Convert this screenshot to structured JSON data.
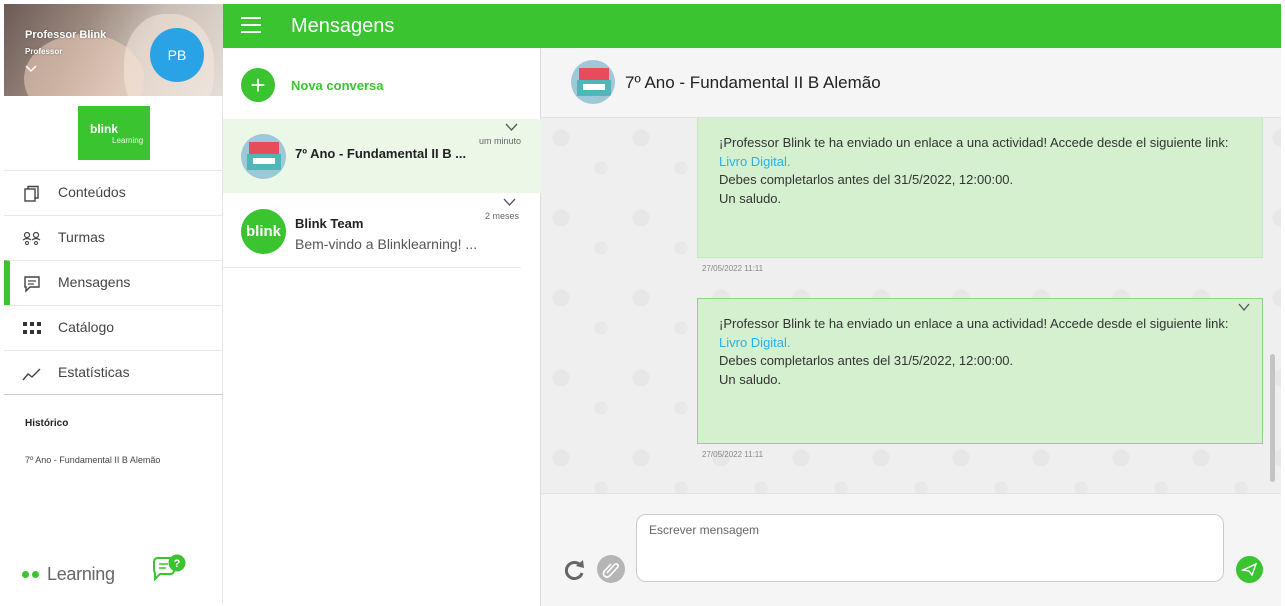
{
  "sidebar": {
    "profile": {
      "name": "Professor Blink",
      "role": "Professor",
      "initials": "PB"
    },
    "logo": {
      "line1": "blink",
      "line2": "Learning"
    },
    "items": [
      {
        "label": "Conteúdos",
        "icon": "document-icon"
      },
      {
        "label": "Turmas",
        "icon": "people-icon"
      },
      {
        "label": "Mensagens",
        "icon": "message-icon",
        "active": true
      },
      {
        "label": "Catálogo",
        "icon": "grid-icon"
      },
      {
        "label": "Estatísticas",
        "icon": "chart-icon"
      }
    ],
    "history": {
      "title": "Histórico",
      "items": [
        "7º Ano - Fundamental II B  Alemão"
      ]
    },
    "footer": {
      "logo_text": "Learning",
      "help_icon": "help-chat-icon"
    }
  },
  "topbar": {
    "title": "Mensagens",
    "menu_icon": "hamburger-icon"
  },
  "conversations": {
    "new_label": "Nova conversa",
    "items": [
      {
        "name": "7º Ano - Fundamental II B ...",
        "time": "um minuto",
        "selected": true
      },
      {
        "name": "Blink Team",
        "preview": "Bem-vindo a Blinklearning! ...",
        "time": "2 meses",
        "avatar_text": "blink"
      }
    ]
  },
  "chat": {
    "title": "7º Ano - Fundamental II B  Alemão",
    "messages": [
      {
        "line1": "¡Professor Blink te ha enviado un enlace a una actividad! Accede desde el siguiente link:",
        "link": "Livro Digital.",
        "line2": "Debes completarlos antes del  31/5/2022, 12:00:00.",
        "line3": "Un saludo.",
        "timestamp": "27/05/2022 11:11"
      },
      {
        "line1": "¡Professor Blink te ha enviado un enlace a una actividad! Accede desde el siguiente link:",
        "link": "Livro Digital.",
        "line2": "Debes completarlos antes del  31/5/2022, 12:00:00.",
        "line3": "Un saludo.",
        "timestamp": "27/05/2022 11:11"
      }
    ],
    "composer": {
      "placeholder": "Escrever mensagem"
    }
  },
  "colors": {
    "brand_green": "#3ac430",
    "bubble": "#d4f0cf",
    "link": "#2ab0e8",
    "avatar": "#2aa3e6"
  }
}
